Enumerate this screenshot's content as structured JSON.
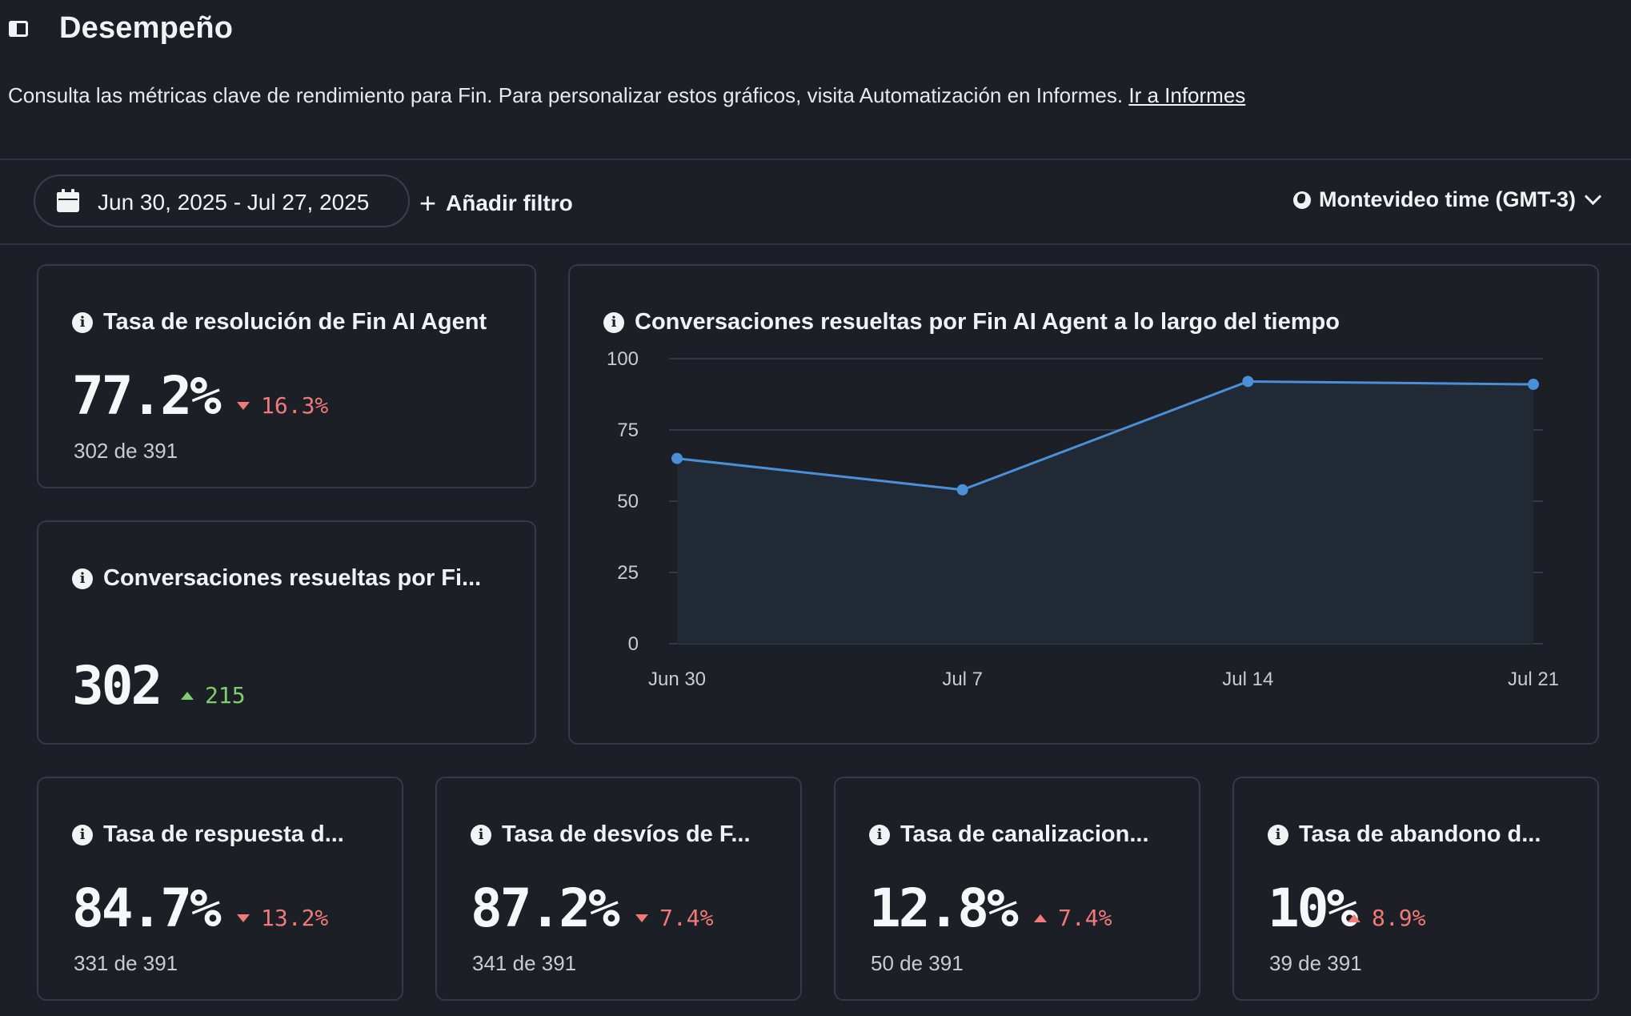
{
  "header": {
    "title": "Desempeño",
    "description": "Consulta las métricas clave de rendimiento para Fin. Para personalizar estos gráficos, visita Automatización en Informes.",
    "link_label": "Ir a Informes",
    "toggle_icon": "sidebar-toggle-icon"
  },
  "toolbar": {
    "date_range": "Jun 30, 2025 - Jul 27, 2025",
    "add_filter": "Añadir filtro",
    "timezone": "Montevideo time (GMT-3)"
  },
  "cards": {
    "resolution_rate": {
      "title": "Tasa de resolución de Fin AI Agent",
      "value": "77.2%",
      "delta": "16.3%",
      "delta_direction": "down",
      "subtext": "302 de 391"
    },
    "resolved_count": {
      "title": "Conversaciones resueltas por Fi...",
      "value": "302",
      "delta": "215",
      "delta_direction": "up"
    },
    "response_rate": {
      "title": "Tasa de respuesta d...",
      "value": "84.7%",
      "delta": "13.2%",
      "delta_direction": "down",
      "subtext": "331 de 391"
    },
    "deflection_rate": {
      "title": "Tasa de desvíos de F...",
      "value": "87.2%",
      "delta": "7.4%",
      "delta_direction": "down",
      "subtext": "341 de 391"
    },
    "routing_rate": {
      "title": "Tasa de canalizacion...",
      "value": "12.8%",
      "delta": "7.4%",
      "delta_direction": "up",
      "subtext": "50 de 391"
    },
    "abandon_rate": {
      "title": "Tasa de abandono d...",
      "value": "10%",
      "delta": "8.9%",
      "delta_direction": "up",
      "subtext": "39 de 391"
    }
  },
  "colors": {
    "background": "#1c1f26",
    "line": "#4a90d9",
    "area": "#222a35",
    "negative": "#f07a7a",
    "positive": "#7fcf6f"
  },
  "chart_data": {
    "type": "area",
    "title": "Conversaciones resueltas por Fin AI Agent a lo largo del tiempo",
    "x": [
      "Jun 30",
      "Jul 7",
      "Jul 14",
      "Jul 21"
    ],
    "series": [
      {
        "values": [
          65,
          54,
          92,
          91
        ]
      }
    ],
    "yticks": [
      0,
      25,
      50,
      75,
      100
    ],
    "ylim": [
      0,
      100
    ],
    "grid": true
  }
}
